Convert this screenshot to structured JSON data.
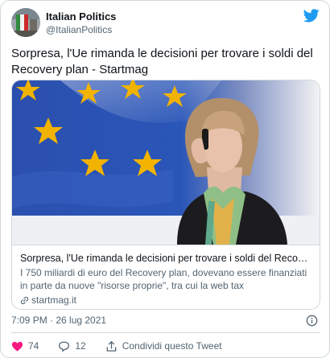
{
  "author": {
    "name": "Italian Politics",
    "handle": "@ItalianPolitics"
  },
  "tweet": {
    "text": "Sorpresa, l'Ue rimanda le decisioni per trovare i soldi del Recovery plan - Startmag",
    "timestamp": "7:09 PM · 26 lug 2021"
  },
  "card": {
    "title": "Sorpresa, l'Ue rimanda le decisioni per trovare i soldi del Recovery plan …",
    "description": "I 750 miliardi di euro del Recovery plan, dovevano essere finanziati in parte da nuove \"risorse proprie\", tra cui la web tax",
    "domain": "startmag.it"
  },
  "actions": {
    "likes": "74",
    "replies": "12",
    "share_label": "Condividi questo Tweet"
  },
  "colors": {
    "text": "#0f1419",
    "secondary": "#536471",
    "twitter_blue": "#1d9bf0",
    "eu_blue": "#1f46a8",
    "eu_yellow": "#f2b300",
    "like_red": "#f91880",
    "border": "#cfd9de"
  },
  "icons": [
    "twitter-bird-icon",
    "link-icon",
    "info-icon",
    "heart-icon",
    "reply-icon",
    "share-icon"
  ]
}
